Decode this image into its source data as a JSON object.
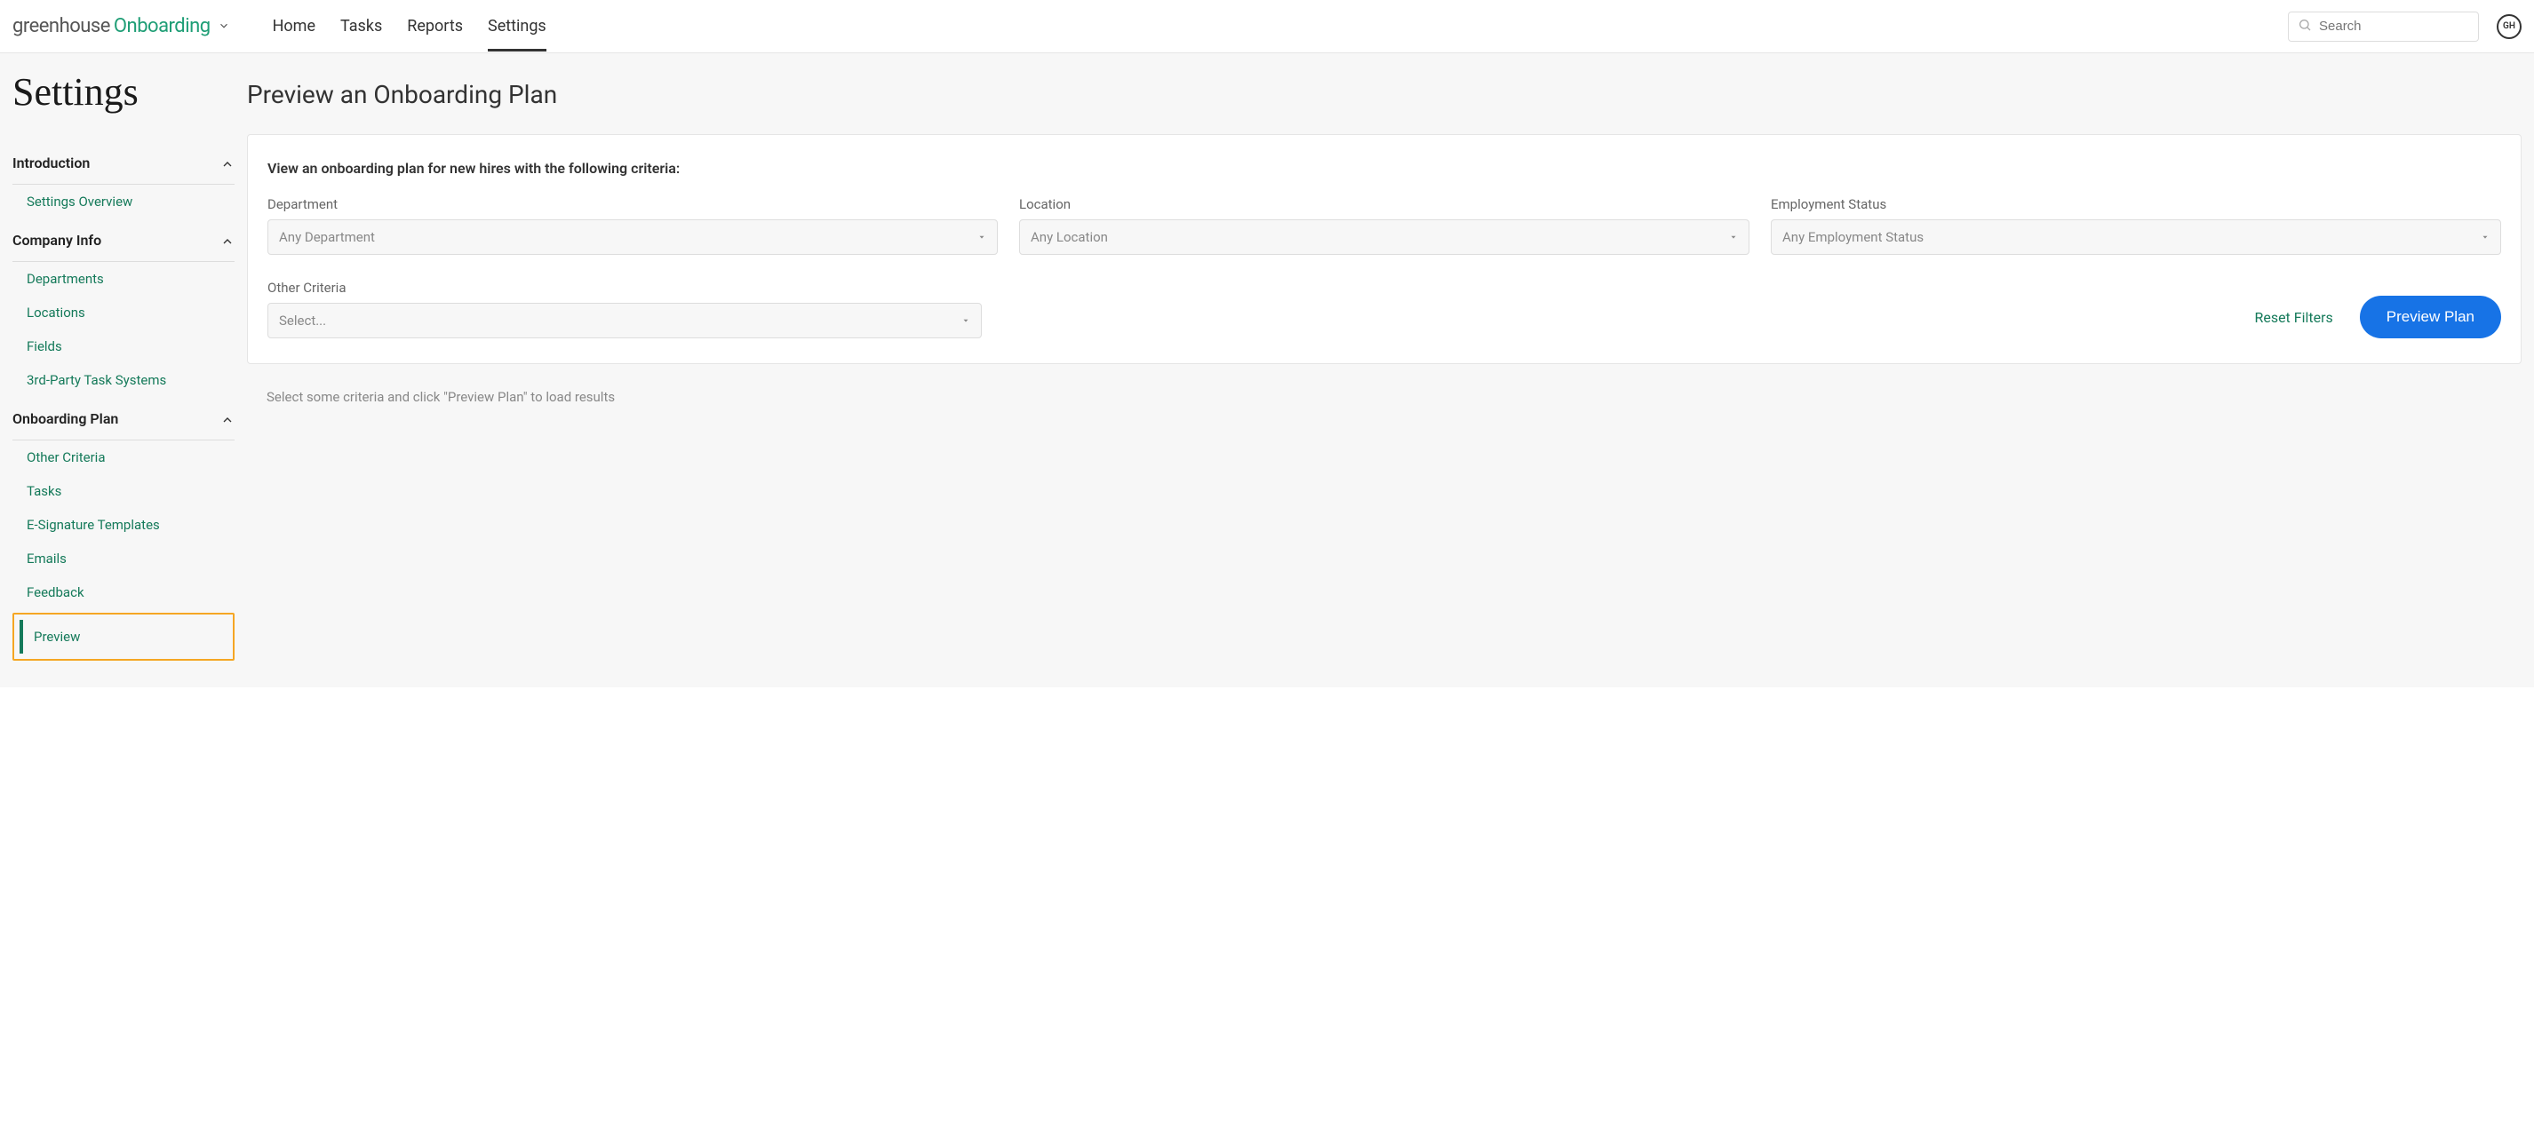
{
  "header": {
    "logo_part1": "greenhouse",
    "logo_part2": "Onboarding",
    "nav": [
      "Home",
      "Tasks",
      "Reports",
      "Settings"
    ],
    "active_nav": "Settings",
    "search_placeholder": "Search",
    "avatar_initials": "GH"
  },
  "sidebar": {
    "page_title": "Settings",
    "sections": [
      {
        "title": "Introduction",
        "items": [
          "Settings Overview"
        ]
      },
      {
        "title": "Company Info",
        "items": [
          "Departments",
          "Locations",
          "Fields",
          "3rd-Party Task Systems"
        ]
      },
      {
        "title": "Onboarding Plan",
        "items": [
          "Other Criteria",
          "Tasks",
          "E-Signature Templates",
          "Emails",
          "Feedback",
          "Preview"
        ],
        "active": "Preview"
      }
    ]
  },
  "main": {
    "title": "Preview an Onboarding Plan",
    "panel_heading": "View an onboarding plan for new hires with the following criteria:",
    "filters": {
      "department": {
        "label": "Department",
        "placeholder": "Any Department"
      },
      "location": {
        "label": "Location",
        "placeholder": "Any Location"
      },
      "employment_status": {
        "label": "Employment Status",
        "placeholder": "Any Employment Status"
      },
      "other": {
        "label": "Other Criteria",
        "placeholder": "Select..."
      }
    },
    "reset_link": "Reset Filters",
    "preview_button": "Preview Plan",
    "hint": "Select some criteria and click \"Preview Plan\" to load results"
  }
}
